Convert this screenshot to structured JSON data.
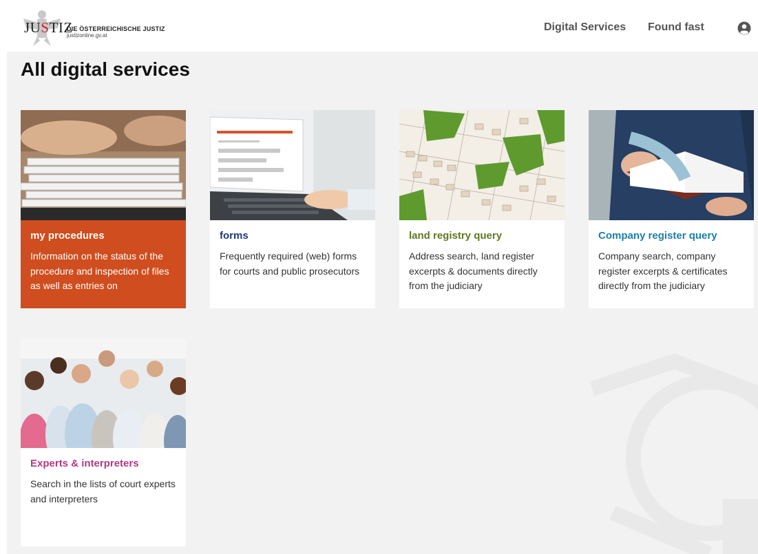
{
  "header": {
    "logo_word_a": "JU",
    "logo_word_b": "S",
    "logo_word_c": "TIZ",
    "logo_title": "DIE ÖSTERREICHISCHE JUSTIZ",
    "logo_url": "justizonline.gv.at",
    "nav": [
      {
        "label": "Digital Services"
      },
      {
        "label": "Found fast"
      }
    ],
    "user_icon": "user-circle-icon"
  },
  "page": {
    "title": "All digital services"
  },
  "colors": {
    "orange": "#cf4d1e",
    "navy": "#1f3a78",
    "olive": "#5e7a24",
    "teal": "#1d7ea6",
    "magenta": "#b23a86",
    "background": "#f2f2f2"
  },
  "cards": [
    {
      "title": "my procedures",
      "description": "Information on the status of the procedure and inspection of files as well as entries on",
      "image": "stack-of-papers-photo"
    },
    {
      "title": "forms",
      "description": "Frequently required (web) forms for courts and public prosecutors",
      "image": "laptop-form-photo"
    },
    {
      "title": "land registry query",
      "description": "Address search, land register excerpts & documents directly from the judiciary",
      "image": "cadastral-map-photo"
    },
    {
      "title": "Company register query",
      "description": "Company search, company register excerpts & certificates directly from the judiciary",
      "image": "open-book-photo"
    },
    {
      "title": "Experts & interpreters",
      "description": "Search in the lists of court experts and interpreters",
      "image": "group-of-people-photo"
    }
  ]
}
